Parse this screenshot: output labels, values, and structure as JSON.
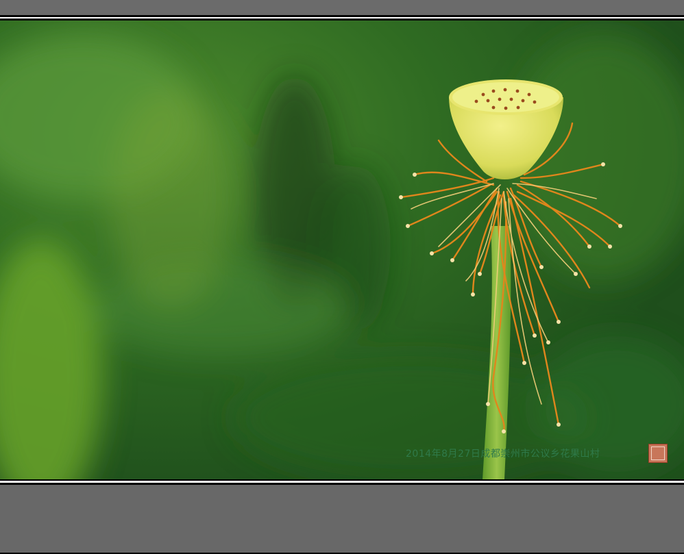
{
  "photo": {
    "subject": "lotus seed pod with stamens",
    "caption": "2014年8月27日成都崇州市公议乡花果山村",
    "seal": "seal-stamp"
  },
  "colors": {
    "frame_gray": "#666666",
    "background_green": "#2f6b22",
    "pod_yellow": "#e6e36a",
    "stamen_orange": "#e58a1f",
    "stem_green": "#7fb23a",
    "caption_green": "#2f7a4a",
    "seal_red": "#c8765a"
  }
}
